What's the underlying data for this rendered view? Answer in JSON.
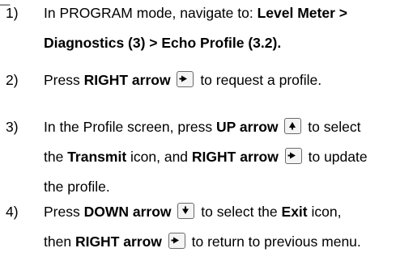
{
  "header": {
    "clipped_text": "_"
  },
  "steps": [
    {
      "number": "1)",
      "line1": {
        "t1": "In PROGRAM mode, navigate to: ",
        "b1": "Level Meter >"
      },
      "line2": {
        "b1": "Diagnostics (3) > Echo Profile (3.2)."
      }
    },
    {
      "number": "2)",
      "line1": {
        "t1": "Press ",
        "b1": "RIGHT arrow",
        "t2": " to request a profile."
      }
    },
    {
      "number": "3)",
      "line1": {
        "t1": "In the Profile screen, press ",
        "b1": "UP arrow",
        "t2": " to select"
      },
      "line2": {
        "t1": "the ",
        "b1": "Transmit",
        "t2": " icon, and ",
        "b2": "RIGHT arrow",
        "t3": " to update"
      },
      "line3": {
        "t1": "the profile."
      }
    },
    {
      "number": "4)",
      "line1": {
        "t1": "Press ",
        "b1": "DOWN arrow",
        "t2": " to select the ",
        "b2": "Exit",
        "t3": " icon,"
      },
      "line2": {
        "t1": "then ",
        "b1": "RIGHT arrow",
        "t2": " to return to previous menu."
      }
    }
  ],
  "icons": {
    "right": "right-arrow-key-icon",
    "up": "up-arrow-key-icon",
    "down": "down-arrow-key-icon"
  },
  "colors": {
    "text": "#000000",
    "key_border": "#6a6a6a",
    "key_fill": "#f4f4f4"
  }
}
